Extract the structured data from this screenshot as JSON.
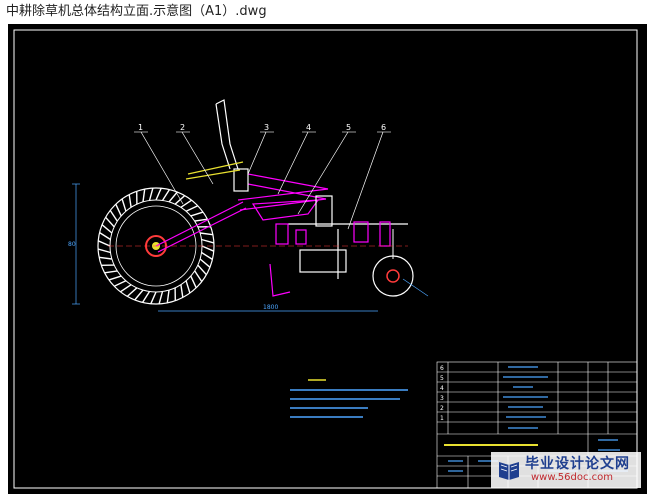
{
  "window": {
    "title": "中耕除草机总体结构立面.示意图（A1）.dwg"
  },
  "drawing": {
    "balloons": [
      "1",
      "2",
      "3",
      "4",
      "5",
      "6"
    ],
    "colors": {
      "background": "#000000",
      "border": "#ffffff",
      "wheel": "#ffffff",
      "frame": "#ff00ff",
      "leader": "#ffffff",
      "dimension": "#4da6ff",
      "hub": "#ff3b3b",
      "parts_yellow": "#e8e030",
      "centerline": "#ff3b3b"
    }
  },
  "watermark": {
    "text": "毕业设计论文网",
    "url": "www.56doc.com",
    "icon": "book-logo-icon"
  }
}
